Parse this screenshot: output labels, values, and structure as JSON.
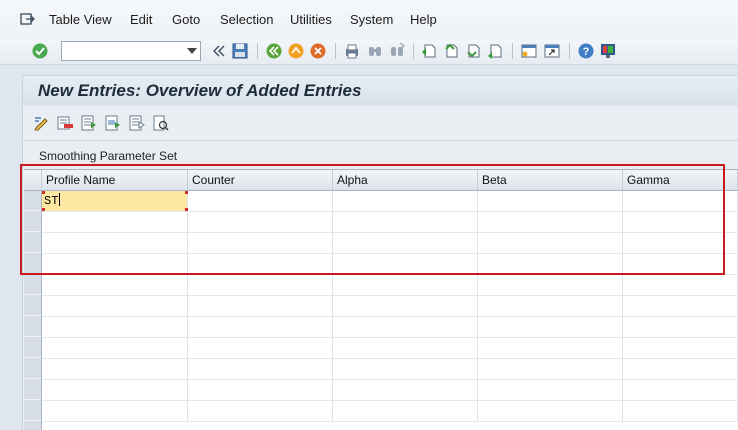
{
  "menubar": {
    "items": [
      {
        "label": "Table View"
      },
      {
        "label": "Edit"
      },
      {
        "label": "Goto"
      },
      {
        "label": "Selection"
      },
      {
        "label": "Utilities"
      },
      {
        "label": "System"
      },
      {
        "label": "Help"
      }
    ]
  },
  "toolbar": {
    "command_field": {
      "value": "",
      "placeholder": ""
    },
    "icons": [
      "enter-check-icon",
      "back-arrows-icon",
      "save-icon",
      "back-icon",
      "exit-icon",
      "cancel-icon",
      "print-icon",
      "find-icon",
      "find-next-icon",
      "first-page-icon",
      "previous-page-icon",
      "next-page-icon",
      "last-page-icon",
      "create-session-icon",
      "shortcut-icon",
      "help-icon",
      "layout-menu-icon"
    ]
  },
  "title": {
    "text": "New Entries: Overview of Added Entries"
  },
  "app_toolbar": {
    "icons": [
      "change-display-icon",
      "delete-row-icon",
      "select-all-icon",
      "select-block-icon",
      "deselect-all-icon",
      "choose-icon"
    ]
  },
  "table": {
    "caption": "Smoothing Parameter Set",
    "columns": [
      "Profile Name",
      "Counter",
      "Alpha",
      "Beta",
      "Gamma"
    ],
    "rows": [
      [
        "ST",
        "",
        "",
        "",
        ""
      ],
      [
        "",
        "",
        "",
        "",
        ""
      ],
      [
        "",
        "",
        "",
        "",
        ""
      ],
      [
        "",
        "",
        "",
        "",
        ""
      ],
      [
        "",
        "",
        "",
        "",
        ""
      ],
      [
        "",
        "",
        "",
        "",
        ""
      ],
      [
        "",
        "",
        "",
        "",
        ""
      ],
      [
        "",
        "",
        "",
        "",
        ""
      ],
      [
        "",
        "",
        "",
        "",
        ""
      ],
      [
        "",
        "",
        "",
        "",
        ""
      ],
      [
        "",
        "",
        "",
        "",
        ""
      ]
    ]
  },
  "colors": {
    "highlight": "#c9191f",
    "active_cell": "#ffe8a1",
    "title_text": "#1e2b3b"
  }
}
